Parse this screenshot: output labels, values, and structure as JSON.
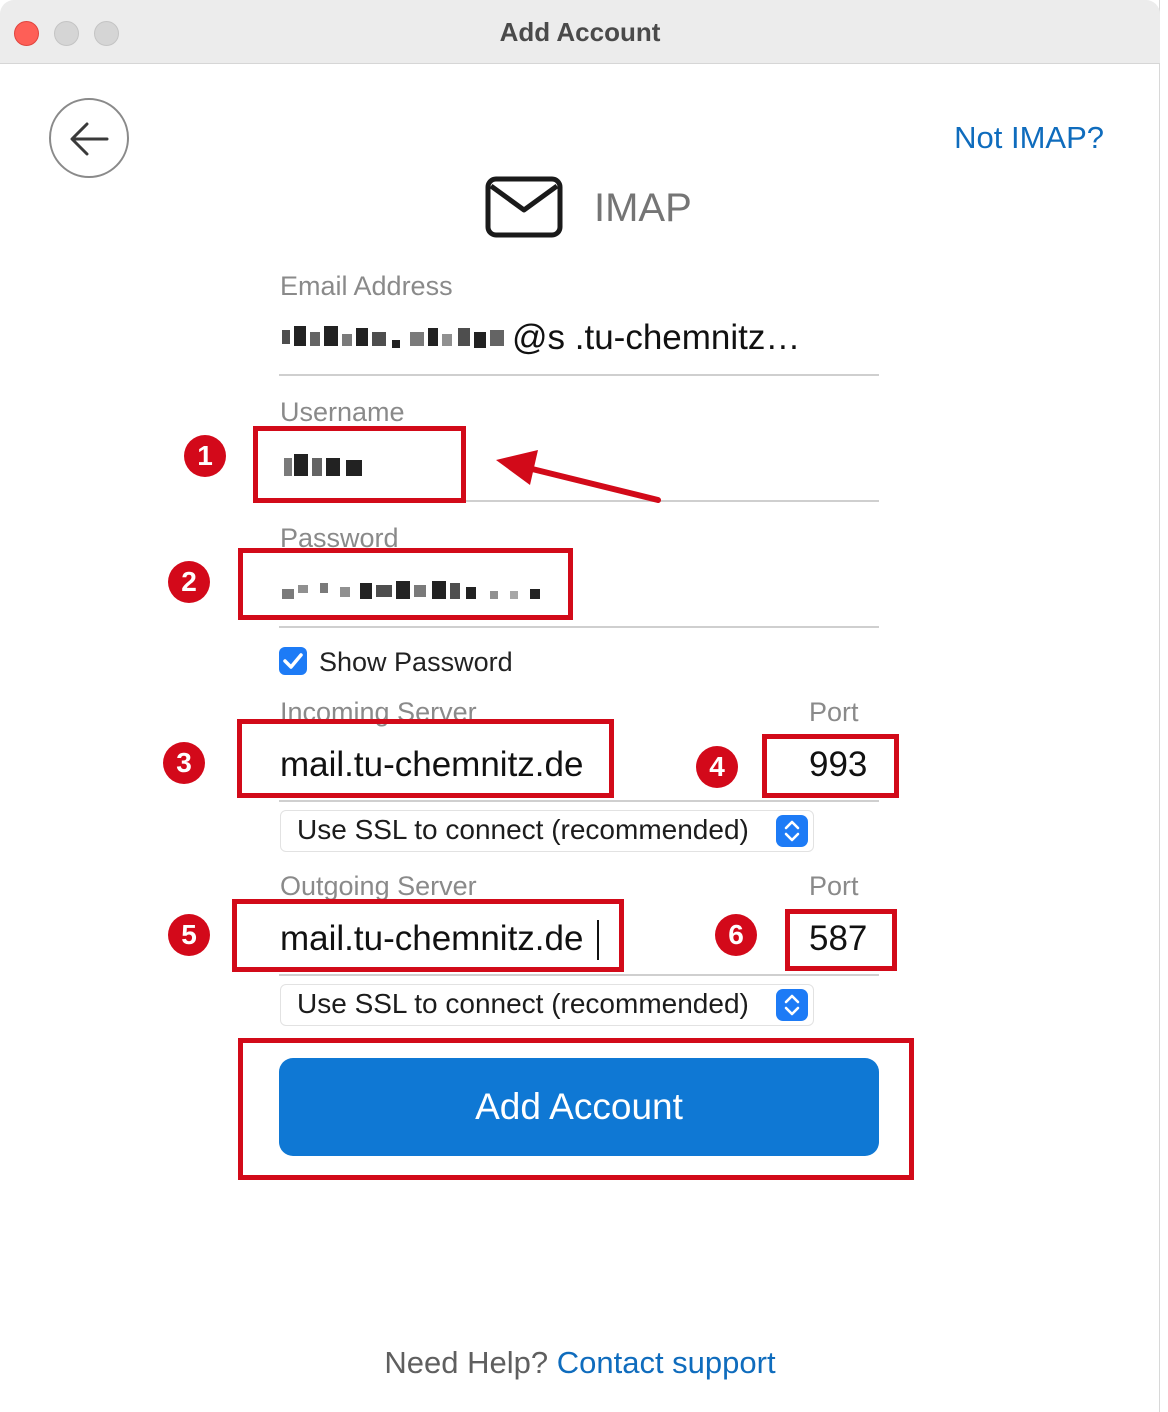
{
  "window": {
    "title": "Add Account"
  },
  "header": {
    "not_imap_label": "Not IMAP?",
    "protocol_label": "IMAP"
  },
  "form": {
    "email_label": "Email Address",
    "email_value": "@s .tu-chemnitz…",
    "username_label": "Username",
    "password_label": "Password",
    "show_password_label": "Show Password",
    "show_password_checked": true,
    "incoming_label": "Incoming Server",
    "incoming_value": "mail.tu-chemnitz.de",
    "incoming_port_label": "Port",
    "incoming_port_value": "993",
    "incoming_ssl": "Use SSL to connect (recommended)",
    "outgoing_label": "Outgoing Server",
    "outgoing_value": "mail.tu-chemnitz.de",
    "outgoing_port_label": "Port",
    "outgoing_port_value": "587",
    "outgoing_ssl": "Use SSL to connect (recommended)",
    "submit_label": "Add Account"
  },
  "annotations": {
    "badges": [
      "1",
      "2",
      "3",
      "4",
      "5",
      "6"
    ],
    "color": "#d20a19"
  },
  "footer": {
    "help_text": "Need Help?",
    "support_link": "Contact support"
  },
  "colors": {
    "accent": "#0f78d4",
    "link": "#0f6cbd",
    "annotation": "#d20a19"
  }
}
